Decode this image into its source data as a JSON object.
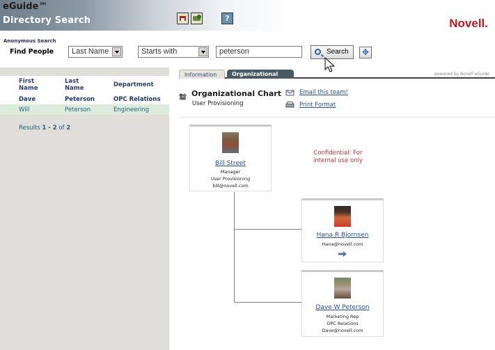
{
  "header": {
    "title": "eGuide™",
    "subtitle": "Directory Search",
    "logo": "Novell.",
    "icons": [
      "home-icon",
      "cart-icon",
      "help-icon"
    ]
  },
  "search": {
    "mode_label": "Anonymous Search",
    "find_label": "Find People",
    "field_value": "Last Name",
    "operator_value": "Starts with",
    "query_value": "peterson",
    "search_button": "Search"
  },
  "results": {
    "columns": [
      "First Name",
      "Last Name",
      "Department"
    ],
    "rows": [
      [
        "Dave",
        "Peterson",
        "OPC Relations"
      ],
      [
        "Will",
        "Peterson",
        "Engineering"
      ]
    ],
    "count_prefix": "Results",
    "count_range": "1 - 2",
    "count_of": "of",
    "count_total": "2"
  },
  "tabs": [
    {
      "label": "Information",
      "active": false
    },
    {
      "label": "Organizational Chart",
      "active": true
    }
  ],
  "powered_by": "powered by Novell eGuide",
  "org": {
    "title": "Organizational Chart",
    "subtitle": "User Provisioning",
    "email_link": "Email this team!",
    "print_link": "Print Format",
    "confidential": "Confidential: For internal use only",
    "manager": {
      "name": "Bill Street",
      "title": "Manager",
      "dept": "User Provisioning",
      "email": "bill@novell.com"
    },
    "reports": [
      {
        "name": "Hana R Bjornsen",
        "email": "Hana@novell.com"
      },
      {
        "name": "Dave W Peterson",
        "title": "Marketing Rep",
        "dept": "OPC Relations",
        "email": "Dave@novell.com"
      }
    ]
  },
  "colors": {
    "brand_red": "#c2191f",
    "link_blue": "#2250a0",
    "header_text_navy": "#2a3d73",
    "confidential_red": "#d02a2a",
    "left_pane_bg": "#e0ded8"
  }
}
